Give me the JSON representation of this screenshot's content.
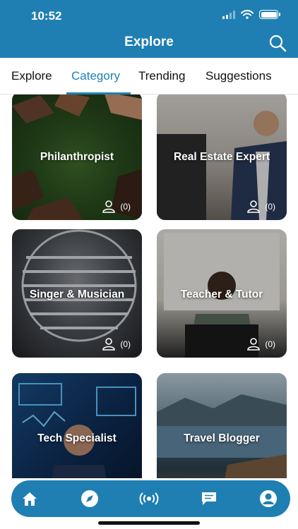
{
  "status_bar": {
    "time": "10:52"
  },
  "header": {
    "title": "Explore",
    "search_icon": "search-icon"
  },
  "tabs": [
    {
      "label": "Explore",
      "active": false
    },
    {
      "label": "Category",
      "active": true
    },
    {
      "label": "Trending",
      "active": false
    },
    {
      "label": "Suggestions",
      "active": false
    }
  ],
  "categories": [
    {
      "name": "Philanthropist",
      "count": "(0)"
    },
    {
      "name": "Real Estate Expert",
      "count": "(0)"
    },
    {
      "name": "Singer & Musician",
      "count": "(0)"
    },
    {
      "name": "Teacher & Tutor",
      "count": "(0)"
    },
    {
      "name": "Tech Specialist",
      "count": ""
    },
    {
      "name": "Travel Blogger",
      "count": ""
    }
  ],
  "bottom_nav": [
    {
      "icon": "home-icon",
      "active": false
    },
    {
      "icon": "compass-icon",
      "active": true
    },
    {
      "icon": "broadcast-icon",
      "active": false
    },
    {
      "icon": "chat-icon",
      "active": false
    },
    {
      "icon": "profile-icon",
      "active": false
    }
  ],
  "colors": {
    "brand": "#1f7fb3",
    "tab_active": "#1f7fb3",
    "text": "#111111"
  }
}
